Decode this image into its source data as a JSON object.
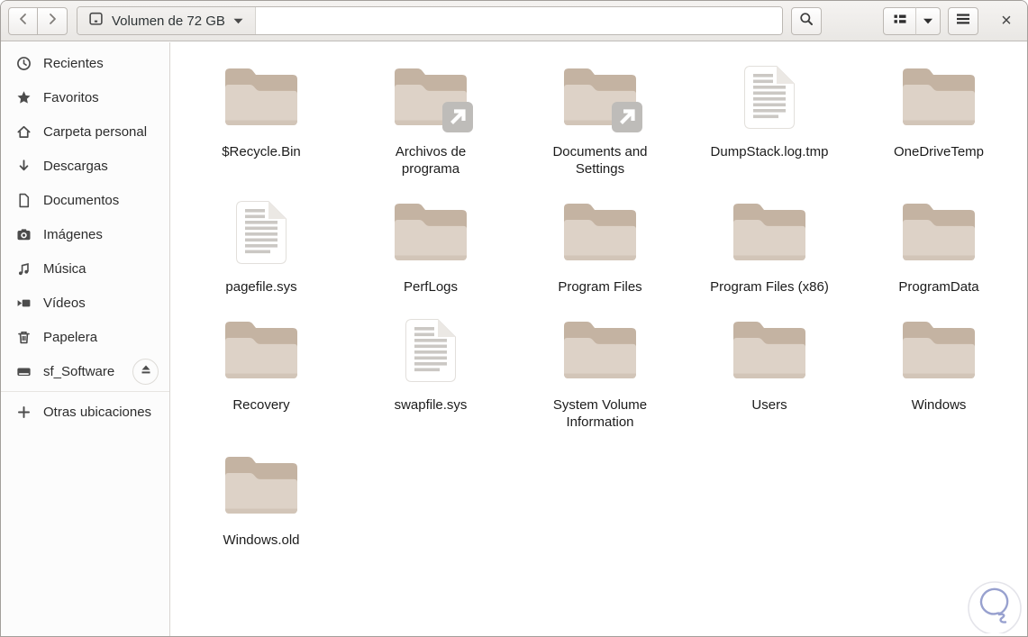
{
  "toolbar": {
    "back_icon": "chevron-left",
    "forward_icon": "chevron-right",
    "location": {
      "icon": "harddisk-icon",
      "label": "Volumen de 72 GB",
      "caret_icon": "chevron-down"
    },
    "search_icon": "magnifier",
    "view_toggle_icon": "list-view",
    "view_caret_icon": "chevron-down",
    "menu_icon": "hamburger",
    "close_icon": "×"
  },
  "sidebar": {
    "items": [
      {
        "label": "Recientes",
        "icon": "clock-icon"
      },
      {
        "label": "Favoritos",
        "icon": "star-icon"
      },
      {
        "label": "Carpeta personal",
        "icon": "home-icon"
      },
      {
        "label": "Descargas",
        "icon": "download-icon"
      },
      {
        "label": "Documentos",
        "icon": "document-icon"
      },
      {
        "label": "Imágenes",
        "icon": "camera-icon"
      },
      {
        "label": "Música",
        "icon": "music-icon"
      },
      {
        "label": "Vídeos",
        "icon": "video-icon"
      },
      {
        "label": "Papelera",
        "icon": "trash-icon"
      },
      {
        "label": "sf_Software",
        "icon": "drive-icon",
        "eject": true
      }
    ],
    "footer_item": {
      "label": "Otras ubicaciones",
      "icon": "plus-icon"
    }
  },
  "grid": {
    "items": [
      {
        "label": "$Recycle.Bin",
        "type": "folder",
        "shortcut": false
      },
      {
        "label": "Archivos de programa",
        "type": "folder",
        "shortcut": true
      },
      {
        "label": "Documents and Settings",
        "type": "folder",
        "shortcut": true
      },
      {
        "label": "DumpStack.log.tmp",
        "type": "file",
        "shortcut": false
      },
      {
        "label": "OneDriveTemp",
        "type": "folder",
        "shortcut": false
      },
      {
        "label": "pagefile.sys",
        "type": "file",
        "shortcut": false
      },
      {
        "label": "PerfLogs",
        "type": "folder",
        "shortcut": false
      },
      {
        "label": "Program Files",
        "type": "folder",
        "shortcut": false
      },
      {
        "label": "Program Files (x86)",
        "type": "folder",
        "shortcut": false
      },
      {
        "label": "ProgramData",
        "type": "folder",
        "shortcut": false
      },
      {
        "label": "Recovery",
        "type": "folder",
        "shortcut": false
      },
      {
        "label": "swapfile.sys",
        "type": "file",
        "shortcut": false
      },
      {
        "label": "System Volume Information",
        "type": "folder",
        "shortcut": false
      },
      {
        "label": "Users",
        "type": "folder",
        "shortcut": false
      },
      {
        "label": "Windows",
        "type": "folder",
        "shortcut": false
      },
      {
        "label": "Windows.old",
        "type": "folder",
        "shortcut": false
      }
    ]
  },
  "watermark": {
    "icon": "solvetic-bulb-logo",
    "color": "#98a1cf"
  },
  "colors": {
    "folder_back": "#c4b3a2",
    "folder_front": "#ddd2c7",
    "folder_lip": "#d2c5b8",
    "emblem_gray": "#bebcb9",
    "toolbar_bg": "#eceae8",
    "text": "#1c1c1c"
  }
}
